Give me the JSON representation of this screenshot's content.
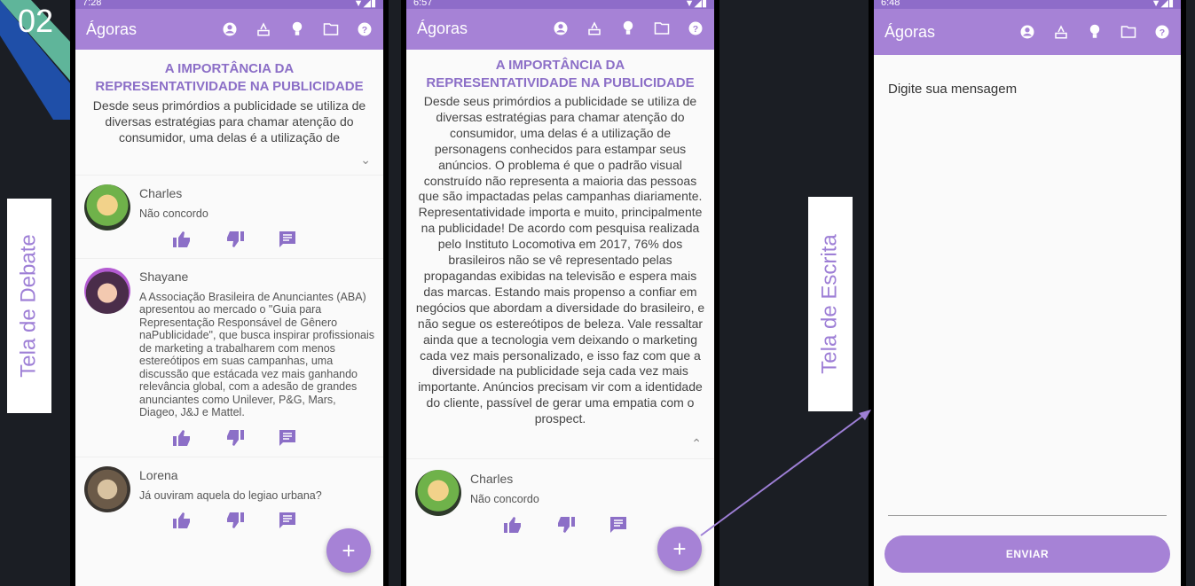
{
  "slide": {
    "number": "02",
    "label_debate": "Tela de Debate",
    "label_writing": "Tela de Escrita",
    "accent_color": "#9e7fd6",
    "deco_colors": [
      "#1f4fa8",
      "#5fb59a"
    ]
  },
  "app": {
    "title": "Ágoras",
    "primary_color": "#a682d6",
    "toolbar_icons": [
      "account-circle-icon",
      "ballot-icon",
      "lightbulb-icon",
      "folder-icon",
      "help-icon"
    ]
  },
  "phone1": {
    "status_time": "7:28",
    "article_title": "A IMPORTÂNCIA DA REPRESENTATIVIDADE NA PUBLICIDADE",
    "article_excerpt": "Desde seus primórdios a publicidade se utiliza de diversas estratégias para chamar atenção do consumidor, uma delas é a utilização de",
    "expand_icon": "chevron-down-icon",
    "comments": [
      {
        "name": "Charles",
        "text": "Não concordo"
      },
      {
        "name": "Shayane",
        "text": "A Associação Brasileira de Anunciantes (ABA) apresentou ao mercado o \"Guia para Representação Responsável de Gênero naPublicidade\", que busca inspirar profissionais de marketing a trabalharem com menos estereótipos em suas campanhas, uma discussão que estácada vez mais ganhando relevância global, com a adesão de grandes anunciantes como Unilever, P&G, Mars, Diageo, J&J e Mattel."
      },
      {
        "name": "Lorena",
        "text": "Já ouviram aquela do legiao urbana?"
      }
    ],
    "fab_label": "+"
  },
  "phone2": {
    "status_time": "6:57",
    "article_title": "A IMPORTÂNCIA DA REPRESENTATIVIDADE NA PUBLICIDADE",
    "article_full": "Desde seus primórdios a publicidade se utiliza de diversas estratégias para chamar atenção do consumidor, uma delas é a utilização de personagens conhecidos para estampar seus anúncios. O problema é que o padrão visual construído não representa a maioria das pessoas que são impactadas pelas campanhas diariamente. Representatividade importa e muito, principalmente na publicidade! De acordo com pesquisa realizada pelo Instituto Locomotiva em 2017, 76% dos brasileiros não se vê representado pelas propagandas exibidas na televisão e espera mais das marcas. Estando mais propenso a confiar em negócios que abordam a diversidade do brasileiro, e não segue os estereótipos de beleza. Vale ressaltar ainda que a tecnologia vem deixando o marketing cada vez mais personalizado, e isso faz com que a diversidade na publicidade seja cada vez mais importante. Anúncios precisam vir com a identidade do cliente, passível de gerar uma empatia com o prospect.",
    "collapse_icon": "chevron-up-icon",
    "comments": [
      {
        "name": "Charles",
        "text": "Não concordo"
      }
    ],
    "fab_label": "+"
  },
  "phone3": {
    "status_time": "6:48",
    "message_placeholder": "Digite sua mensagem",
    "send_label": "ENVIAR"
  }
}
